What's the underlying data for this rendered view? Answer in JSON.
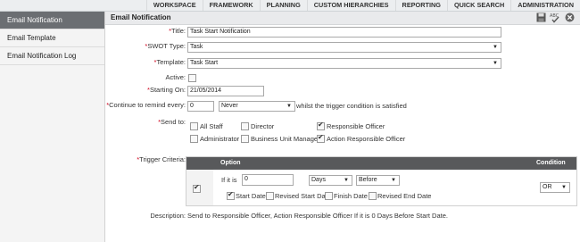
{
  "nav": {
    "items": [
      "WORKSPACE",
      "FRAMEWORK",
      "PLANNING",
      "CUSTOM HIERARCHIES",
      "REPORTING",
      "QUICK SEARCH",
      "ADMINISTRATION"
    ]
  },
  "sidebar": {
    "items": [
      {
        "label": "Email Notification",
        "active": true
      },
      {
        "label": "Email Template",
        "active": false
      },
      {
        "label": "Email Notification Log",
        "active": false
      }
    ]
  },
  "header": {
    "title": "Email Notification",
    "icons": [
      "save-icon",
      "spell-check-icon",
      "close-icon"
    ]
  },
  "form": {
    "title_label": "Title:",
    "title_value": "Task Start Notification",
    "swot_label": "SWOT Type:",
    "swot_value": "Task",
    "template_label": "Template:",
    "template_value": "Task Start",
    "active_label": "Active:",
    "starting_label": "Starting On:",
    "starting_value": "21/05/2014",
    "remind_label": "Continue to remind every:",
    "remind_value": "0",
    "remind_unit": "Never",
    "remind_suffix": "whilst the trigger condition is satisfied",
    "sendto_label": "Send to:",
    "sendto_options": [
      {
        "label": "All Staff",
        "checked": false
      },
      {
        "label": "Director",
        "checked": false
      },
      {
        "label": "Responsible Officer",
        "checked": true
      },
      {
        "label": "Administrator",
        "checked": false
      },
      {
        "label": "Business Unit Manager",
        "checked": false
      },
      {
        "label": "Action Responsible Officer",
        "checked": true
      }
    ]
  },
  "trigger": {
    "label": "Trigger Criteria:",
    "col_option": "Option",
    "col_condition": "Condition",
    "if_label": "If it is",
    "amount": "0",
    "unit": "Days",
    "relation": "Before",
    "dates": [
      {
        "label": "Start Date",
        "checked": true
      },
      {
        "label": "Revised Start Date",
        "checked": false
      },
      {
        "label": "Finish Date",
        "checked": false
      },
      {
        "label": "Revised End Date",
        "checked": false
      }
    ],
    "condition": "OR"
  },
  "description": {
    "label": "Description:",
    "text": "Send to Responsible Officer, Action Responsible Officer If it is 0 Days Before Start Date."
  }
}
